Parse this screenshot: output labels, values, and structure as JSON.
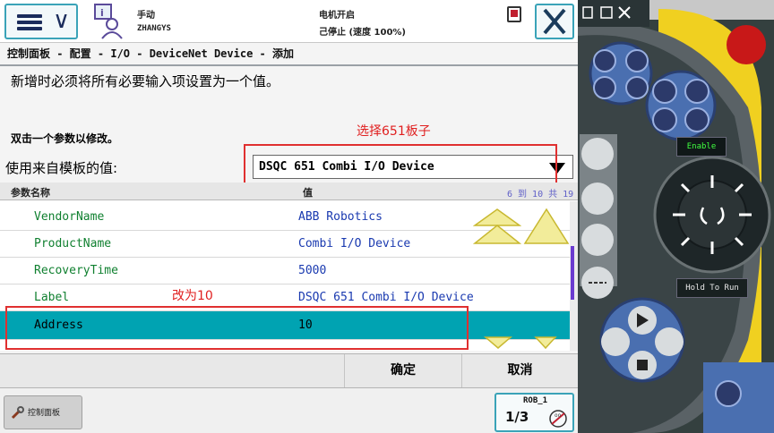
{
  "topbar": {
    "mode": "手动",
    "user": "ZHANGYS",
    "motor_status": "电机开启",
    "run_status": "己停止 (速度 100%)"
  },
  "breadcrumb": "控制面板 - 配置 - I/O - DeviceNet Device - 添加",
  "instruction": "新增时必须将所有必要输入项设置为一个值。",
  "double_click_hint": "双击一个参数以修改。",
  "template": {
    "label": "使用来自模板的值:",
    "selected": "DSQC 651 Combi I/O Device"
  },
  "annotations": {
    "select_board": "选择651板子",
    "change_to": "改为10"
  },
  "table": {
    "col_name": "参数名称",
    "col_value": "值",
    "count": "6 到 10 共 19",
    "rows": [
      {
        "name": "VendorName",
        "value": "ABB Robotics"
      },
      {
        "name": "ProductName",
        "value": "Combi I/O Device"
      },
      {
        "name": "RecoveryTime",
        "value": "5000"
      },
      {
        "name": "Label",
        "value": "DSQC 651 Combi I/O Device"
      },
      {
        "name": "Address",
        "value": "10"
      }
    ],
    "selected_row": 4
  },
  "actions": {
    "ok": "确定",
    "cancel": "取消"
  },
  "taskbar": {
    "control_panel": "控制面板",
    "robot": "ROB_1",
    "speed_fraction": "1/3"
  },
  "pendant": {
    "enable_label": "Enable",
    "hold_label": "Hold To Run"
  },
  "colors": {
    "accent_teal": "#00a3b2",
    "annotation_red": "#e02020",
    "param_green": "#108030",
    "value_blue": "#1a3ab0"
  }
}
